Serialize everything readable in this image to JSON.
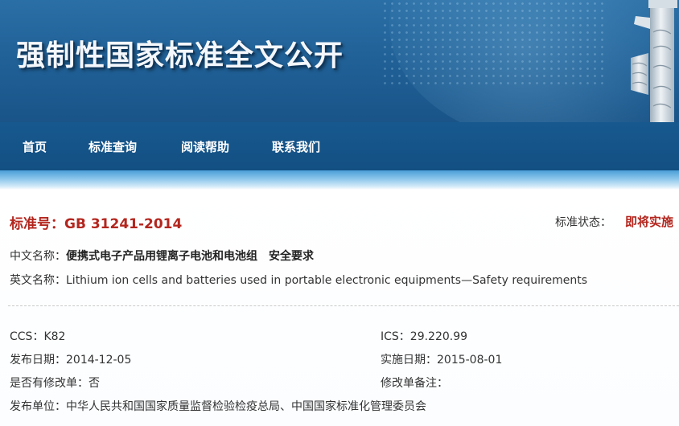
{
  "header": {
    "site_title": "强制性国家标准全文公开"
  },
  "nav": {
    "items": [
      "首页",
      "标准查询",
      "阅读帮助",
      "联系我们"
    ]
  },
  "standard": {
    "number_label": "标准号：",
    "number": "GB 31241-2014",
    "status_label": "标准状态：",
    "status": "即将实施",
    "cn_name_label": "中文名称：",
    "cn_name": "便携式电子产品用锂离子电池和电池组　安全要求",
    "en_name_label": "英文名称：",
    "en_name": "Lithium ion cells and batteries used in portable electronic equipments—Safety requirements",
    "ccs_label": "CCS：",
    "ccs": "K82",
    "ics_label": "ICS：",
    "ics": "29.220.99",
    "publish_date_label": "发布日期：",
    "publish_date": "2014-12-05",
    "impl_date_label": "实施日期：",
    "impl_date": "2015-08-01",
    "amendment_label": "是否有修改单：",
    "amendment": "否",
    "amendment_note_label": "修改单备注：",
    "amendment_note": "",
    "publisher_label": "发布单位：",
    "publisher": "中华人民共和国国家质量监督检验检疫总局、中国国家标准化管理委员会"
  },
  "colors": {
    "banner_blue": "#1f5f95",
    "nav_blue": "#17598f",
    "accent_red": "#b3261e"
  }
}
